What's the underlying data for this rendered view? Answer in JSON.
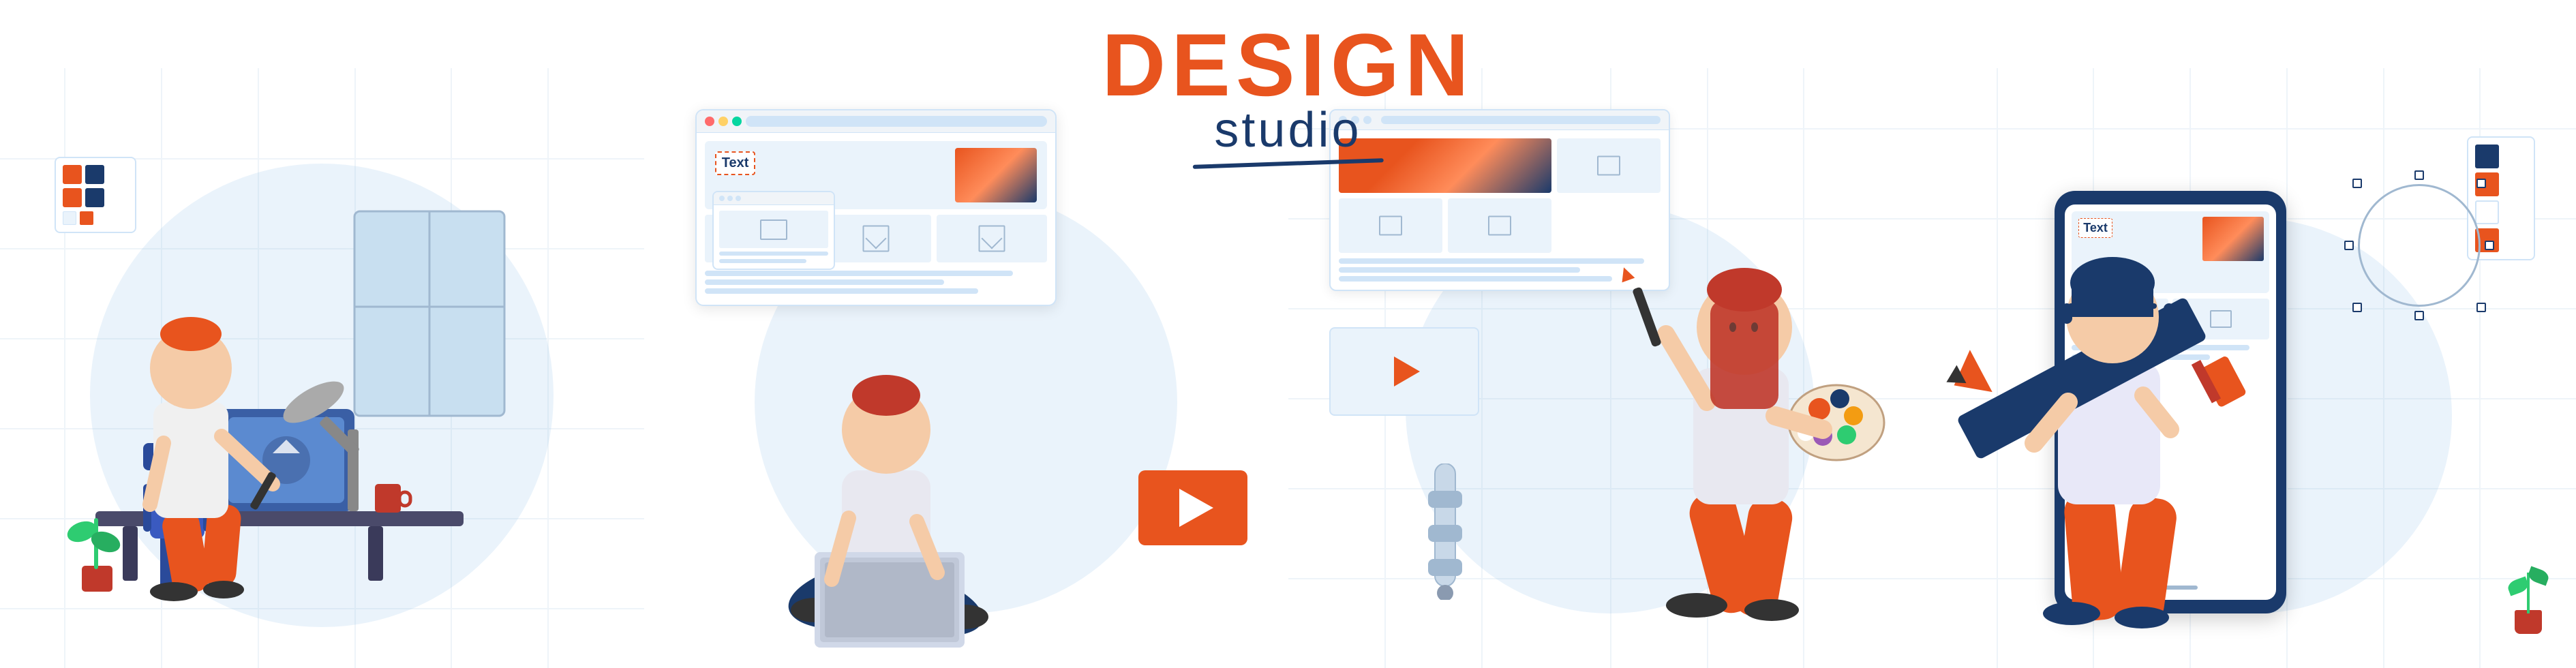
{
  "title": {
    "design": "DESIGN",
    "studio": "studio"
  },
  "panel1": {
    "label": "Designer at desk",
    "palette": {
      "swatches": [
        "#E8541E",
        "#1A3A6B",
        "#E8541E",
        "#1A3A6B",
        "#E8541E",
        "#1A3A6B"
      ]
    }
  },
  "panel2": {
    "label": "Woman with laptop",
    "browser_text": "Text",
    "video_play": "▶"
  },
  "panel3": {
    "label": "Designer with color palette",
    "video_play": "▶"
  },
  "panel4": {
    "label": "Mobile design with pencil",
    "mobile_text": "Text",
    "color_swatches": [
      "#1A3A6B",
      "#E8541E",
      "#ffffff",
      "#E8541E"
    ]
  },
  "colors": {
    "orange": "#E8541E",
    "navy": "#1A3A6B",
    "light_blue": "#EAF3FB",
    "mid_blue": "#a0b8d0",
    "white": "#ffffff"
  }
}
